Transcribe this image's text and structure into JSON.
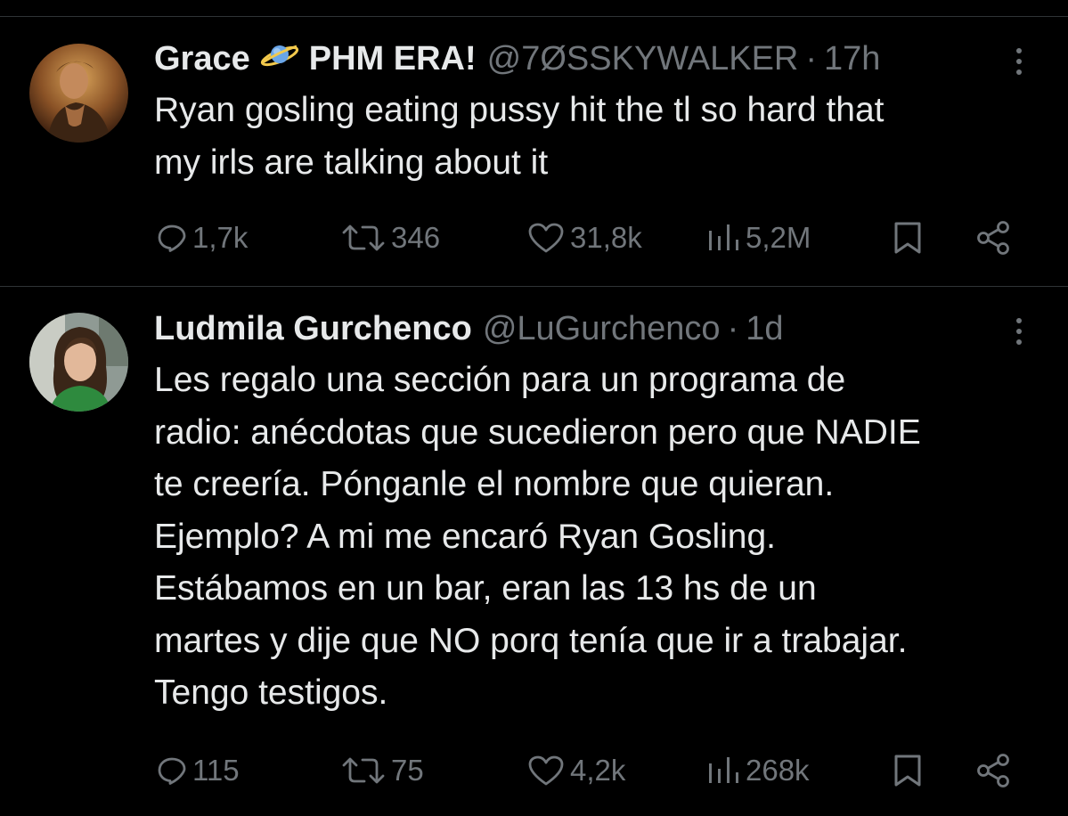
{
  "tweets": [
    {
      "display_name": "Grace",
      "name_emoji": "planet-icon",
      "display_name_suffix": "PHM ERA!",
      "handle": "@7ØSSKYWALKER",
      "separator": "·",
      "time": "17h",
      "text": "Ryan gosling eating pussy hit the tl so hard that\nmy irls are talking about it",
      "replies": "1,7k",
      "retweets": "346",
      "likes": "31,8k",
      "views": "5,2M"
    },
    {
      "display_name": "Ludmila Gurchenco",
      "handle": "@LuGurchenco",
      "separator": "·",
      "time": "1d",
      "text": "Les regalo una sección para un programa de\nradio: anécdotas que sucedieron pero que NADIE\nte creería. Pónganle el nombre que quieran.\nEjemplo? A mi me encaró Ryan Gosling.\nEstábamos en un bar, eran las 13 hs de un\nmartes y dije que NO porq tenía que ir a trabajar.\nTengo testigos.",
      "replies": "115",
      "retweets": "75",
      "likes": "4,2k",
      "views": "268k"
    }
  ],
  "colors": {
    "background": "#000000",
    "text_primary": "#e7e9ea",
    "text_secondary": "#71767b",
    "divider": "#2f3336"
  },
  "icons": {
    "reply": "reply-icon",
    "retweet": "retweet-icon",
    "like": "heart-icon",
    "views": "views-icon",
    "bookmark": "bookmark-icon",
    "share": "share-icon",
    "more": "more-vertical-icon"
  }
}
